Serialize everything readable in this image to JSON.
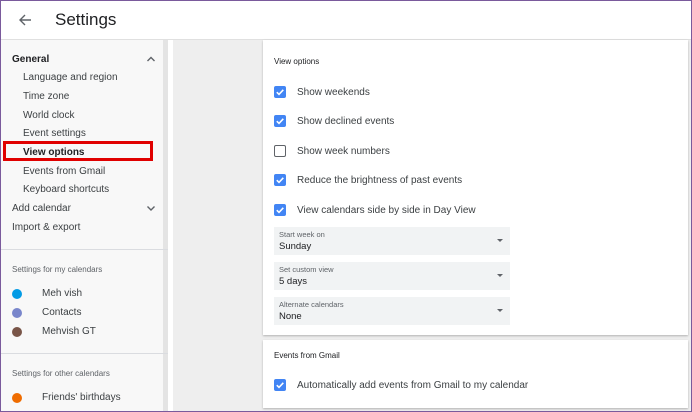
{
  "header": {
    "title": "Settings"
  },
  "sidebar": {
    "general": {
      "label": "General",
      "items": [
        {
          "label": "Language and region"
        },
        {
          "label": "Time zone"
        },
        {
          "label": "World clock"
        },
        {
          "label": "Event settings"
        },
        {
          "label": "View options",
          "selected": true
        },
        {
          "label": "Events from Gmail"
        },
        {
          "label": "Keyboard shortcuts"
        }
      ]
    },
    "add_calendar": "Add calendar",
    "import_export": "Import & export",
    "my_calendars": {
      "label": "Settings for my calendars",
      "items": [
        {
          "name": "Meh vish",
          "color": "#039be5"
        },
        {
          "name": "Contacts",
          "color": "#7986cb"
        },
        {
          "name": "Mehvish GT",
          "color": "#795548"
        }
      ]
    },
    "other_calendars": {
      "label": "Settings for other calendars",
      "items": [
        {
          "name": "Friends' birthdays",
          "color": "#ef6c00"
        }
      ]
    }
  },
  "view_options": {
    "title": "View options",
    "checkboxes": [
      {
        "label": "Show weekends",
        "checked": true
      },
      {
        "label": "Show declined events",
        "checked": true
      },
      {
        "label": "Show week numbers",
        "checked": false
      },
      {
        "label": "Reduce the brightness of past events",
        "checked": true
      },
      {
        "label": "View calendars side by side in Day View",
        "checked": true
      }
    ],
    "selects": [
      {
        "label": "Start week on",
        "value": "Sunday"
      },
      {
        "label": "Set custom view",
        "value": "5 days"
      },
      {
        "label": "Alternate calendars",
        "value": "None"
      }
    ]
  },
  "events_from_gmail": {
    "title": "Events from Gmail",
    "checkbox": {
      "label": "Automatically add events from Gmail to my calendar",
      "checked": true
    }
  },
  "colors": {
    "accent": "#4285f4",
    "highlight": "#e00000"
  }
}
